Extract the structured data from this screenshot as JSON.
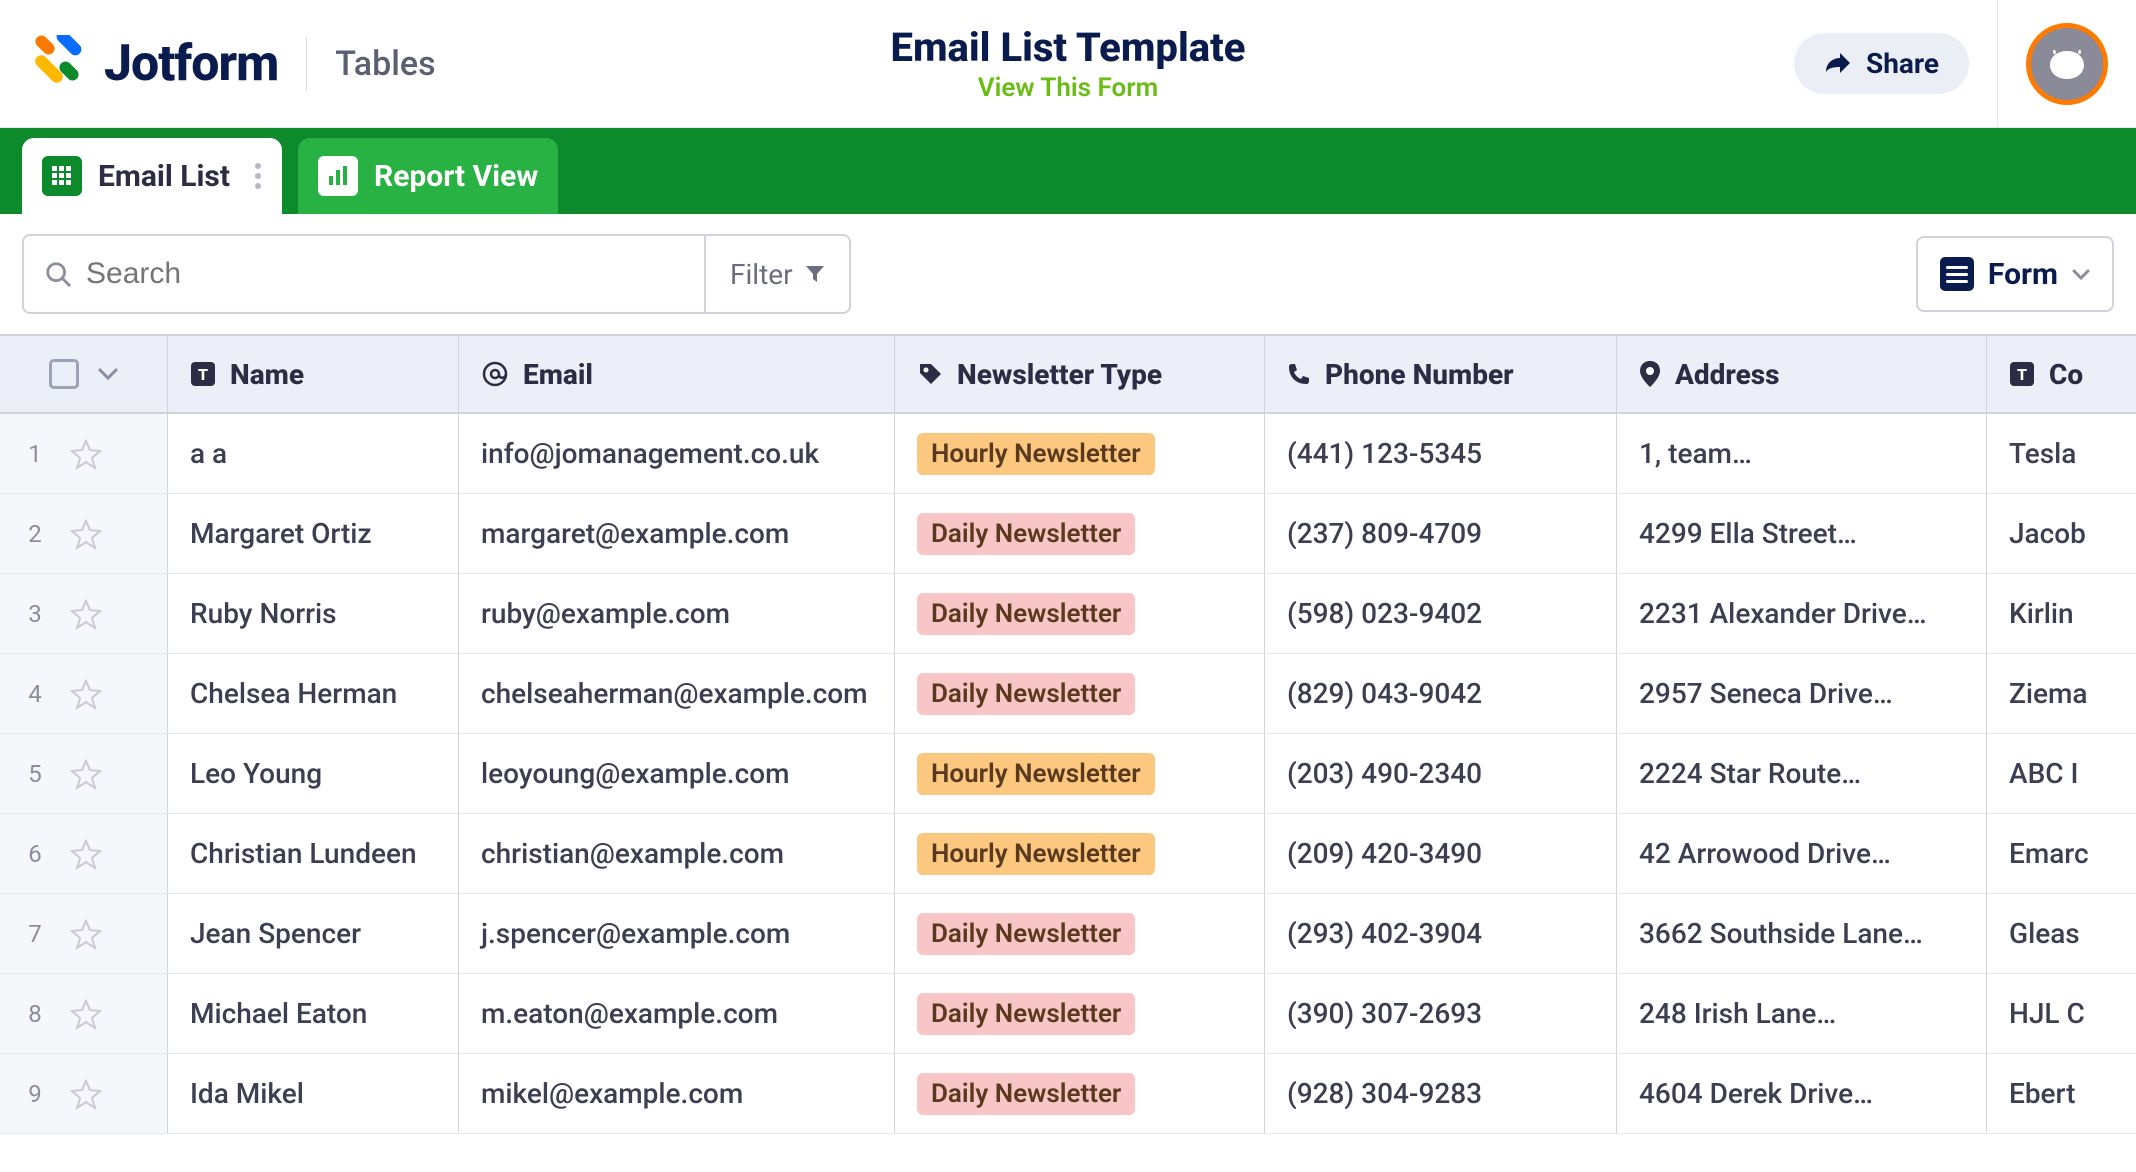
{
  "header": {
    "brand": "Jotform",
    "section": "Tables",
    "title": "Email List Template",
    "view_link": "View This Form",
    "share_label": "Share"
  },
  "tabs": [
    {
      "label": "Email List",
      "active": true
    },
    {
      "label": "Report View",
      "active": false
    }
  ],
  "toolbar": {
    "search_placeholder": "Search",
    "filter_label": "Filter",
    "form_button_label": "Form"
  },
  "columns": {
    "name": "Name",
    "email": "Email",
    "newsletter_type": "Newsletter Type",
    "phone": "Phone Number",
    "address": "Address",
    "company": "Co"
  },
  "newsletter_types": {
    "hourly": "Hourly Newsletter",
    "daily": "Daily Newsletter"
  },
  "rows": [
    {
      "idx": "1",
      "name": "a a",
      "email": "info@jomanagement.co.uk",
      "type": "hourly",
      "phone": "(441) 123-5345",
      "address": "1, team…",
      "company": "Tesla"
    },
    {
      "idx": "2",
      "name": "Margaret Ortiz",
      "email": "margaret@example.com",
      "type": "daily",
      "phone": "(237) 809-4709",
      "address": "4299 Ella Street…",
      "company": "Jacob"
    },
    {
      "idx": "3",
      "name": "Ruby Norris",
      "email": "ruby@example.com",
      "type": "daily",
      "phone": "(598) 023-9402",
      "address": "2231 Alexander Drive…",
      "company": "Kirlin"
    },
    {
      "idx": "4",
      "name": "Chelsea Herman",
      "email": "chelseaherman@example.com",
      "type": "daily",
      "phone": "(829) 043-9042",
      "address": "2957 Seneca Drive…",
      "company": "Ziema"
    },
    {
      "idx": "5",
      "name": "Leo Young",
      "email": "leoyoung@example.com",
      "type": "hourly",
      "phone": "(203) 490-2340",
      "address": "2224 Star Route…",
      "company": "ABC I"
    },
    {
      "idx": "6",
      "name": "Christian Lundeen",
      "email": "christian@example.com",
      "type": "hourly",
      "phone": "(209) 420-3490",
      "address": "42 Arrowood Drive…",
      "company": "Emarc"
    },
    {
      "idx": "7",
      "name": "Jean Spencer",
      "email": "j.spencer@example.com",
      "type": "daily",
      "phone": "(293) 402-3904",
      "address": "3662 Southside Lane…",
      "company": "Gleas"
    },
    {
      "idx": "8",
      "name": "Michael Eaton",
      "email": "m.eaton@example.com",
      "type": "daily",
      "phone": "(390) 307-2693",
      "address": "248 Irish Lane…",
      "company": "HJL C"
    },
    {
      "idx": "9",
      "name": "Ida Mikel",
      "email": "mikel@example.com",
      "type": "daily",
      "phone": "(928) 304-9283",
      "address": "4604 Derek Drive…",
      "company": "Ebert"
    }
  ]
}
